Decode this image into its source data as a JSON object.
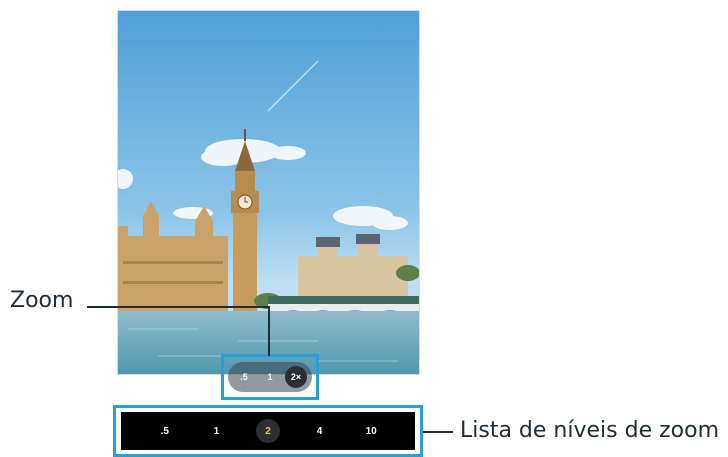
{
  "callouts": {
    "zoom_label": "Zoom",
    "zoom_levels_label": "Lista de níveis de zoom"
  },
  "zoom_pill": {
    "options": [
      ".5",
      "1",
      "2×"
    ],
    "selected": "2×"
  },
  "zoom_list": {
    "levels": [
      ".5",
      "1",
      "2",
      "4",
      "10"
    ],
    "selected": "2"
  },
  "colors": {
    "highlight": "#2a9fd6",
    "active_level_text": "#f3c64a",
    "callout_text": "#1f2e36"
  }
}
